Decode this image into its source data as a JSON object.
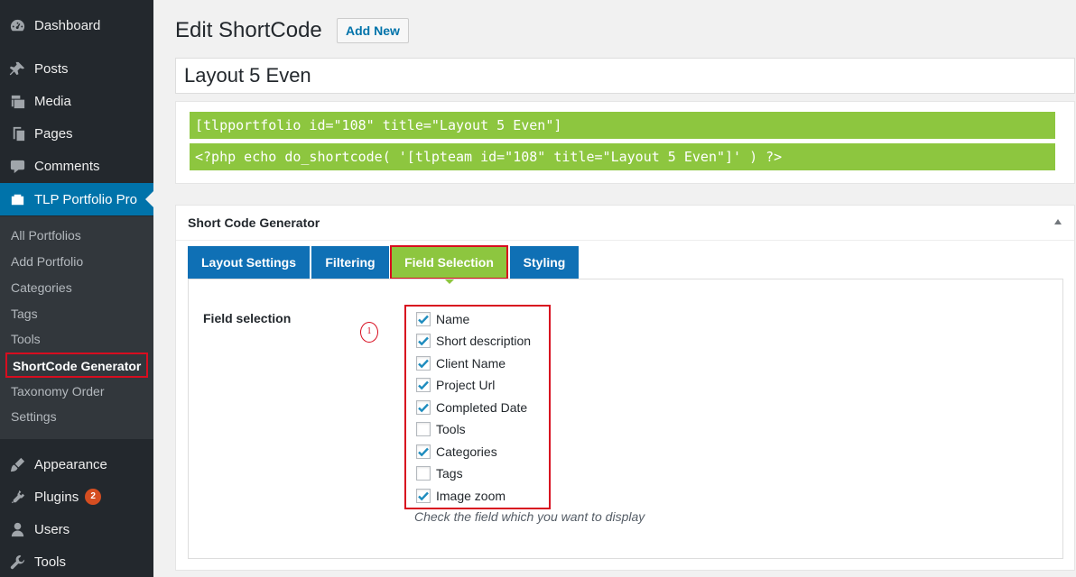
{
  "sidebar": {
    "top_items": [
      {
        "label": "Dashboard",
        "icon": "dashboard-icon"
      },
      {
        "label": "Posts",
        "icon": "pin-icon"
      },
      {
        "label": "Media",
        "icon": "media-icon"
      },
      {
        "label": "Pages",
        "icon": "page-icon"
      },
      {
        "label": "Comments",
        "icon": "comment-icon"
      },
      {
        "label": "TLP Portfolio Pro",
        "icon": "portfolio-icon",
        "current": true
      }
    ],
    "submenu": [
      {
        "label": "All Portfolios"
      },
      {
        "label": "Add Portfolio"
      },
      {
        "label": "Categories"
      },
      {
        "label": "Tags"
      },
      {
        "label": "Tools"
      },
      {
        "label": "ShortCode Generator",
        "current": true
      },
      {
        "label": "Taxonomy Order"
      },
      {
        "label": "Settings"
      }
    ],
    "bottom_items": [
      {
        "label": "Appearance",
        "icon": "brush-icon"
      },
      {
        "label": "Plugins",
        "icon": "plugin-icon",
        "badge": "2"
      },
      {
        "label": "Users",
        "icon": "user-icon"
      },
      {
        "label": "Tools",
        "icon": "wrench-icon"
      }
    ]
  },
  "header": {
    "title": "Edit ShortCode",
    "add_new_label": "Add New"
  },
  "post_title": "Layout 5 Even",
  "shortcodes": {
    "shortcode": "[tlpportfolio id=\"108\" title=\"Layout 5 Even\"]",
    "php": "<?php echo do_shortcode( '[tlpteam id=\"108\" title=\"Layout 5 Even\"]' ) ?>"
  },
  "generator": {
    "title": "Short Code Generator",
    "tabs": [
      {
        "label": "Layout Settings",
        "active": false
      },
      {
        "label": "Filtering",
        "active": false
      },
      {
        "label": "Field Selection",
        "active": true
      },
      {
        "label": "Styling",
        "active": false
      }
    ],
    "field_selection": {
      "label": "Field selection",
      "marker": "1",
      "fields": [
        {
          "label": "Name",
          "checked": true
        },
        {
          "label": "Short description",
          "checked": true
        },
        {
          "label": "Client Name",
          "checked": true
        },
        {
          "label": "Project Url",
          "checked": true
        },
        {
          "label": "Completed Date",
          "checked": true
        },
        {
          "label": "Tools",
          "checked": false
        },
        {
          "label": "Categories",
          "checked": true
        },
        {
          "label": "Tags",
          "checked": false
        },
        {
          "label": "Image zoom",
          "checked": true
        }
      ],
      "help": "Check the field which you want to display"
    }
  },
  "colors": {
    "sidebar_bg": "#23282d",
    "accent_blue": "#0073aa",
    "tab_blue": "#0f70b5",
    "shortcode_green": "#8dc63f",
    "highlight_red": "#d80d1f",
    "checkbox_blue": "#1e8cbe"
  }
}
